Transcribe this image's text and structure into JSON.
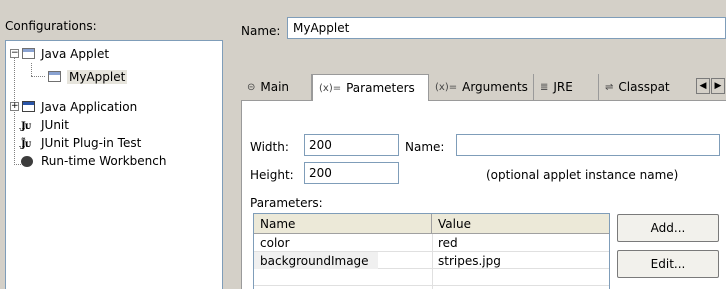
{
  "left_panel": {
    "title": "Configurations:",
    "tree": [
      {
        "label": "Java Applet",
        "icon": "applet-icon",
        "expander": "−"
      },
      {
        "label": "MyApplet",
        "icon": "applet-icon"
      },
      {
        "label": "Java Application",
        "icon": "application-icon",
        "expander": "+"
      },
      {
        "label": "JUnit",
        "icon": "junit-icon"
      },
      {
        "label": "JUnit Plug-in Test",
        "icon": "junit-plugin-icon"
      },
      {
        "label": "Run-time Workbench",
        "icon": "workbench-icon"
      }
    ]
  },
  "name": {
    "label": "Name:",
    "value": "MyApplet"
  },
  "tabs": [
    {
      "label": "Main",
      "icon": "⊝"
    },
    {
      "label": "Parameters",
      "icon": "(x)="
    },
    {
      "label": "Arguments",
      "icon": "(x)="
    },
    {
      "label": "JRE",
      "icon": "≣"
    },
    {
      "label": "Classpat",
      "icon": "⇌"
    }
  ],
  "scroll": {
    "left": "◀",
    "right": "▶"
  },
  "fields": {
    "width_label": "Width:",
    "width_value": "200",
    "height_label": "Height:",
    "height_value": "200",
    "name_label": "Name:",
    "name_value": "",
    "hint": "(optional applet instance name)"
  },
  "parameters": {
    "label": "Parameters:",
    "columns": [
      "Name",
      "Value"
    ],
    "rows": [
      {
        "name": "color",
        "value": "red"
      },
      {
        "name": "backgroundImage",
        "value": "stripes.jpg"
      }
    ]
  },
  "buttons": {
    "add": "Add...",
    "edit": "Edit..."
  }
}
